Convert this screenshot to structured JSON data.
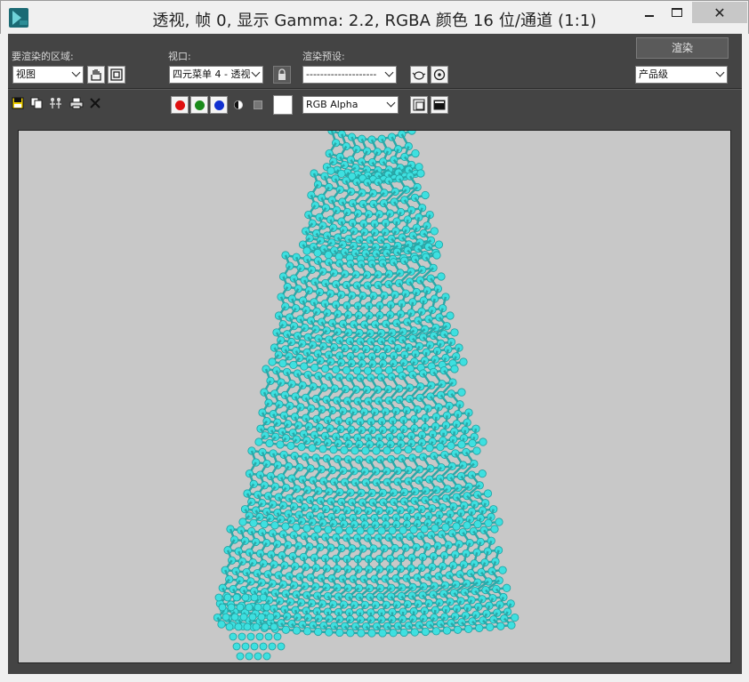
{
  "window": {
    "title": "透视, 帧 0, 显示 Gamma: 2.2, RGBA 颜色 16 位/通道 (1:1)",
    "close_glyph": "✕"
  },
  "toolbar": {
    "area_label": "要渲染的区域:",
    "area_value": "视图",
    "viewport_label": "视口:",
    "viewport_value": "四元菜单 4 - 透视",
    "preset_label": "渲染预设:",
    "preset_value": "--------------------",
    "render_button": "渲染",
    "production_value": "产品级",
    "channel_value": "RGB Alpha"
  },
  "colors": {
    "panel": "#444444",
    "viewport_bg": "#c8c8c8",
    "molecule": "#3ee0e0",
    "red_channel": "#e01010",
    "green_channel": "#1a8a1a",
    "blue_channel": "#1030d0"
  },
  "icons": {
    "save": "floppy-icon",
    "copy": "copy-icon",
    "clone": "clone-icon",
    "print": "print-icon",
    "clear": "close-icon"
  }
}
